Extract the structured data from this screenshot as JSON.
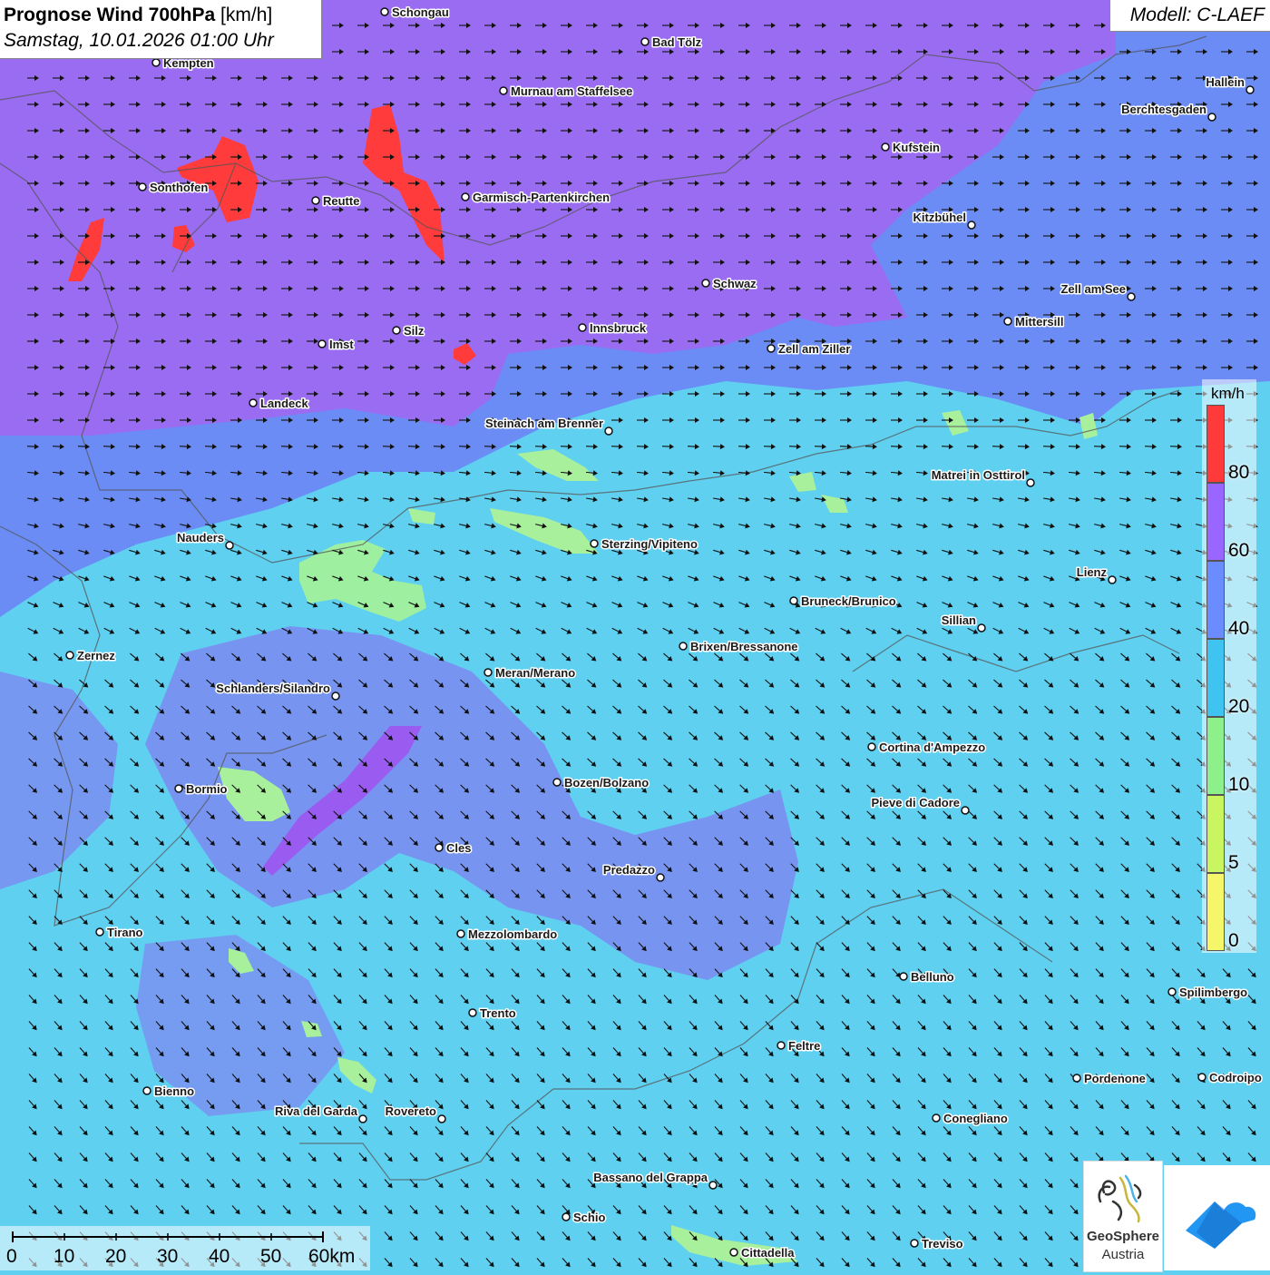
{
  "header": {
    "title_bold": "Prognose Wind 700hPa",
    "title_unit": " [km/h]",
    "datetime": "Samstag, 10.01.2026 01:00 Uhr",
    "model": "Modell: C-LAEF"
  },
  "legend": {
    "unit": "km/h",
    "ticks": [
      "80",
      "60",
      "40",
      "20",
      "10",
      "5",
      "0"
    ],
    "colors": [
      "#ff3a3a",
      "#9966ff",
      "#6a8cff",
      "#3fc3f0",
      "#8ef08a",
      "#c8f560",
      "#f6f66a"
    ]
  },
  "scale_bar": {
    "labels": [
      "0",
      "10",
      "20",
      "30",
      "40",
      "50",
      "60km"
    ]
  },
  "logos": {
    "geosphere_line1": "GeoSphere",
    "geosphere_line2": "Austria"
  },
  "cities": [
    {
      "name": "Schongau"
    },
    {
      "name": "Bad Tölz"
    },
    {
      "name": "Kempten"
    },
    {
      "name": "Murnau am Staffelsee"
    },
    {
      "name": "Hallein"
    },
    {
      "name": "Berchtesgaden"
    },
    {
      "name": "Kufstein"
    },
    {
      "name": "Sonthofen"
    },
    {
      "name": "Reutte"
    },
    {
      "name": "Garmisch-Partenkirchen"
    },
    {
      "name": "Kitzbühel"
    },
    {
      "name": "Schwaz"
    },
    {
      "name": "Zell am See"
    },
    {
      "name": "Mittersill"
    },
    {
      "name": "Innsbruck"
    },
    {
      "name": "Silz"
    },
    {
      "name": "Imst"
    },
    {
      "name": "Zell am Ziller"
    },
    {
      "name": "Landeck"
    },
    {
      "name": "Steinach am Brenner"
    },
    {
      "name": "Matrei in Osttirol"
    },
    {
      "name": "Nauders"
    },
    {
      "name": "Sterzing/Vipiteno"
    },
    {
      "name": "Lienz"
    },
    {
      "name": "Bruneck/Brunico"
    },
    {
      "name": "Sillian"
    },
    {
      "name": "Zernez"
    },
    {
      "name": "Brixen/Bressanone"
    },
    {
      "name": "Meran/Merano"
    },
    {
      "name": "Schlanders/Silandro"
    },
    {
      "name": "Cortina d'Ampezzo"
    },
    {
      "name": "Bozen/Bolzano"
    },
    {
      "name": "Bormio"
    },
    {
      "name": "Pieve di Cadore"
    },
    {
      "name": "Cles"
    },
    {
      "name": "Predazzo"
    },
    {
      "name": "Tirano"
    },
    {
      "name": "Mezzolombardo"
    },
    {
      "name": "Belluno"
    },
    {
      "name": "Spilimbergo"
    },
    {
      "name": "Trento"
    },
    {
      "name": "Feltre"
    },
    {
      "name": "Bienno"
    },
    {
      "name": "Pordenone"
    },
    {
      "name": "Codroipo"
    },
    {
      "name": "Riva del Garda"
    },
    {
      "name": "Rovereto"
    },
    {
      "name": "Conegliano"
    },
    {
      "name": "Bassano del Grappa"
    },
    {
      "name": "Schio"
    },
    {
      "name": "Treviso"
    },
    {
      "name": "Cittadella"
    }
  ]
}
